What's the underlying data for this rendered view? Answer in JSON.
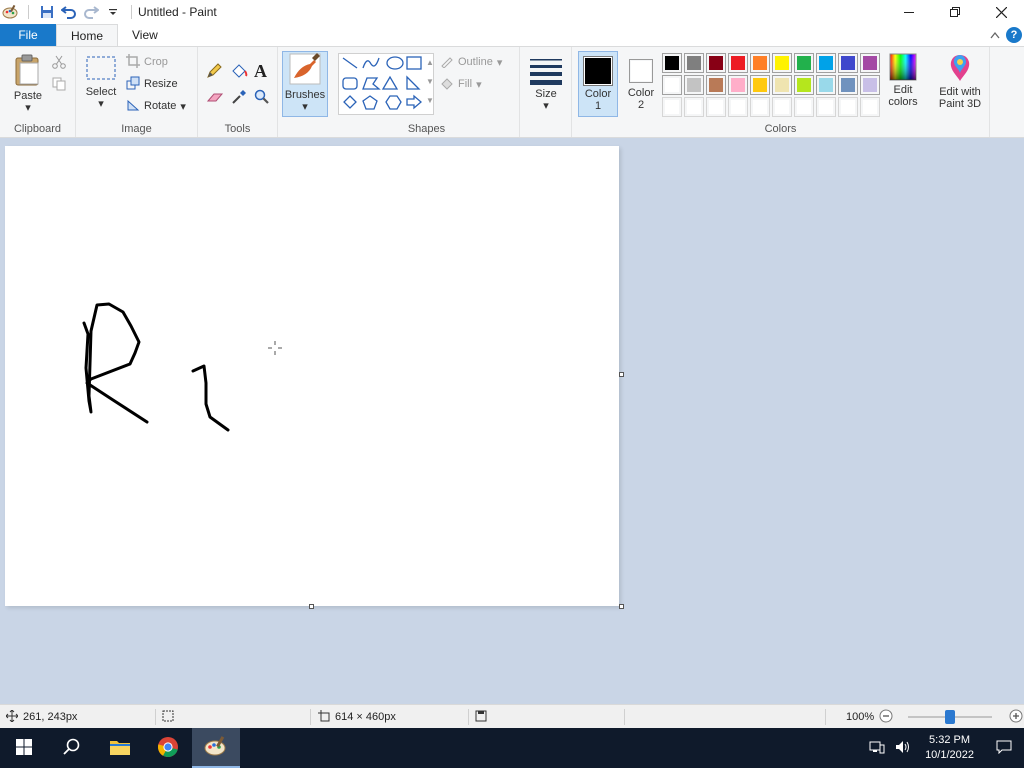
{
  "title_bar": {
    "title": "Untitled - Paint"
  },
  "tabs": {
    "file": "File",
    "home": "Home",
    "view": "View"
  },
  "clipboard": {
    "paste": "Paste",
    "group_label": "Clipboard"
  },
  "image": {
    "select": "Select",
    "crop": "Crop",
    "resize": "Resize",
    "rotate": "Rotate",
    "group_label": "Image"
  },
  "tools": {
    "group_label": "Tools"
  },
  "brushes": {
    "label": "Brushes"
  },
  "shapes": {
    "outline": "Outline",
    "fill": "Fill",
    "group_label": "Shapes"
  },
  "size": {
    "label": "Size"
  },
  "colors": {
    "color1_line1": "Color",
    "color1_line2": "1",
    "color2_line1": "Color",
    "color2_line2": "2",
    "color1_value": "#000000",
    "color2_value": "#ffffff",
    "palette_row1": [
      "#000000",
      "#7f7f7f",
      "#880015",
      "#ed1c24",
      "#ff7f27",
      "#fff200",
      "#22b14c",
      "#00a2e8",
      "#3f48cc",
      "#a349a4"
    ],
    "palette_row2": [
      "#ffffff",
      "#c3c3c3",
      "#b97a57",
      "#ffaec9",
      "#ffc90e",
      "#efe4b0",
      "#b5e61d",
      "#99d9ea",
      "#7092be",
      "#c8bfe7"
    ],
    "palette_row3": [
      "",
      "",
      "",
      "",
      "",
      "",
      "",
      "",
      "",
      ""
    ],
    "edit_colors_line1": "Edit",
    "edit_colors_line2": "colors",
    "group_label": "Colors"
  },
  "paint3d": {
    "line1": "Edit with",
    "line2": "Paint 3D"
  },
  "status_bar": {
    "cursor_position": "261, 243px",
    "image_size": "614 × 460px",
    "zoom": "100%",
    "zoom_fraction": 0.5
  },
  "taskbar": {
    "time": "5:32 PM",
    "date": "10/1/2022"
  }
}
